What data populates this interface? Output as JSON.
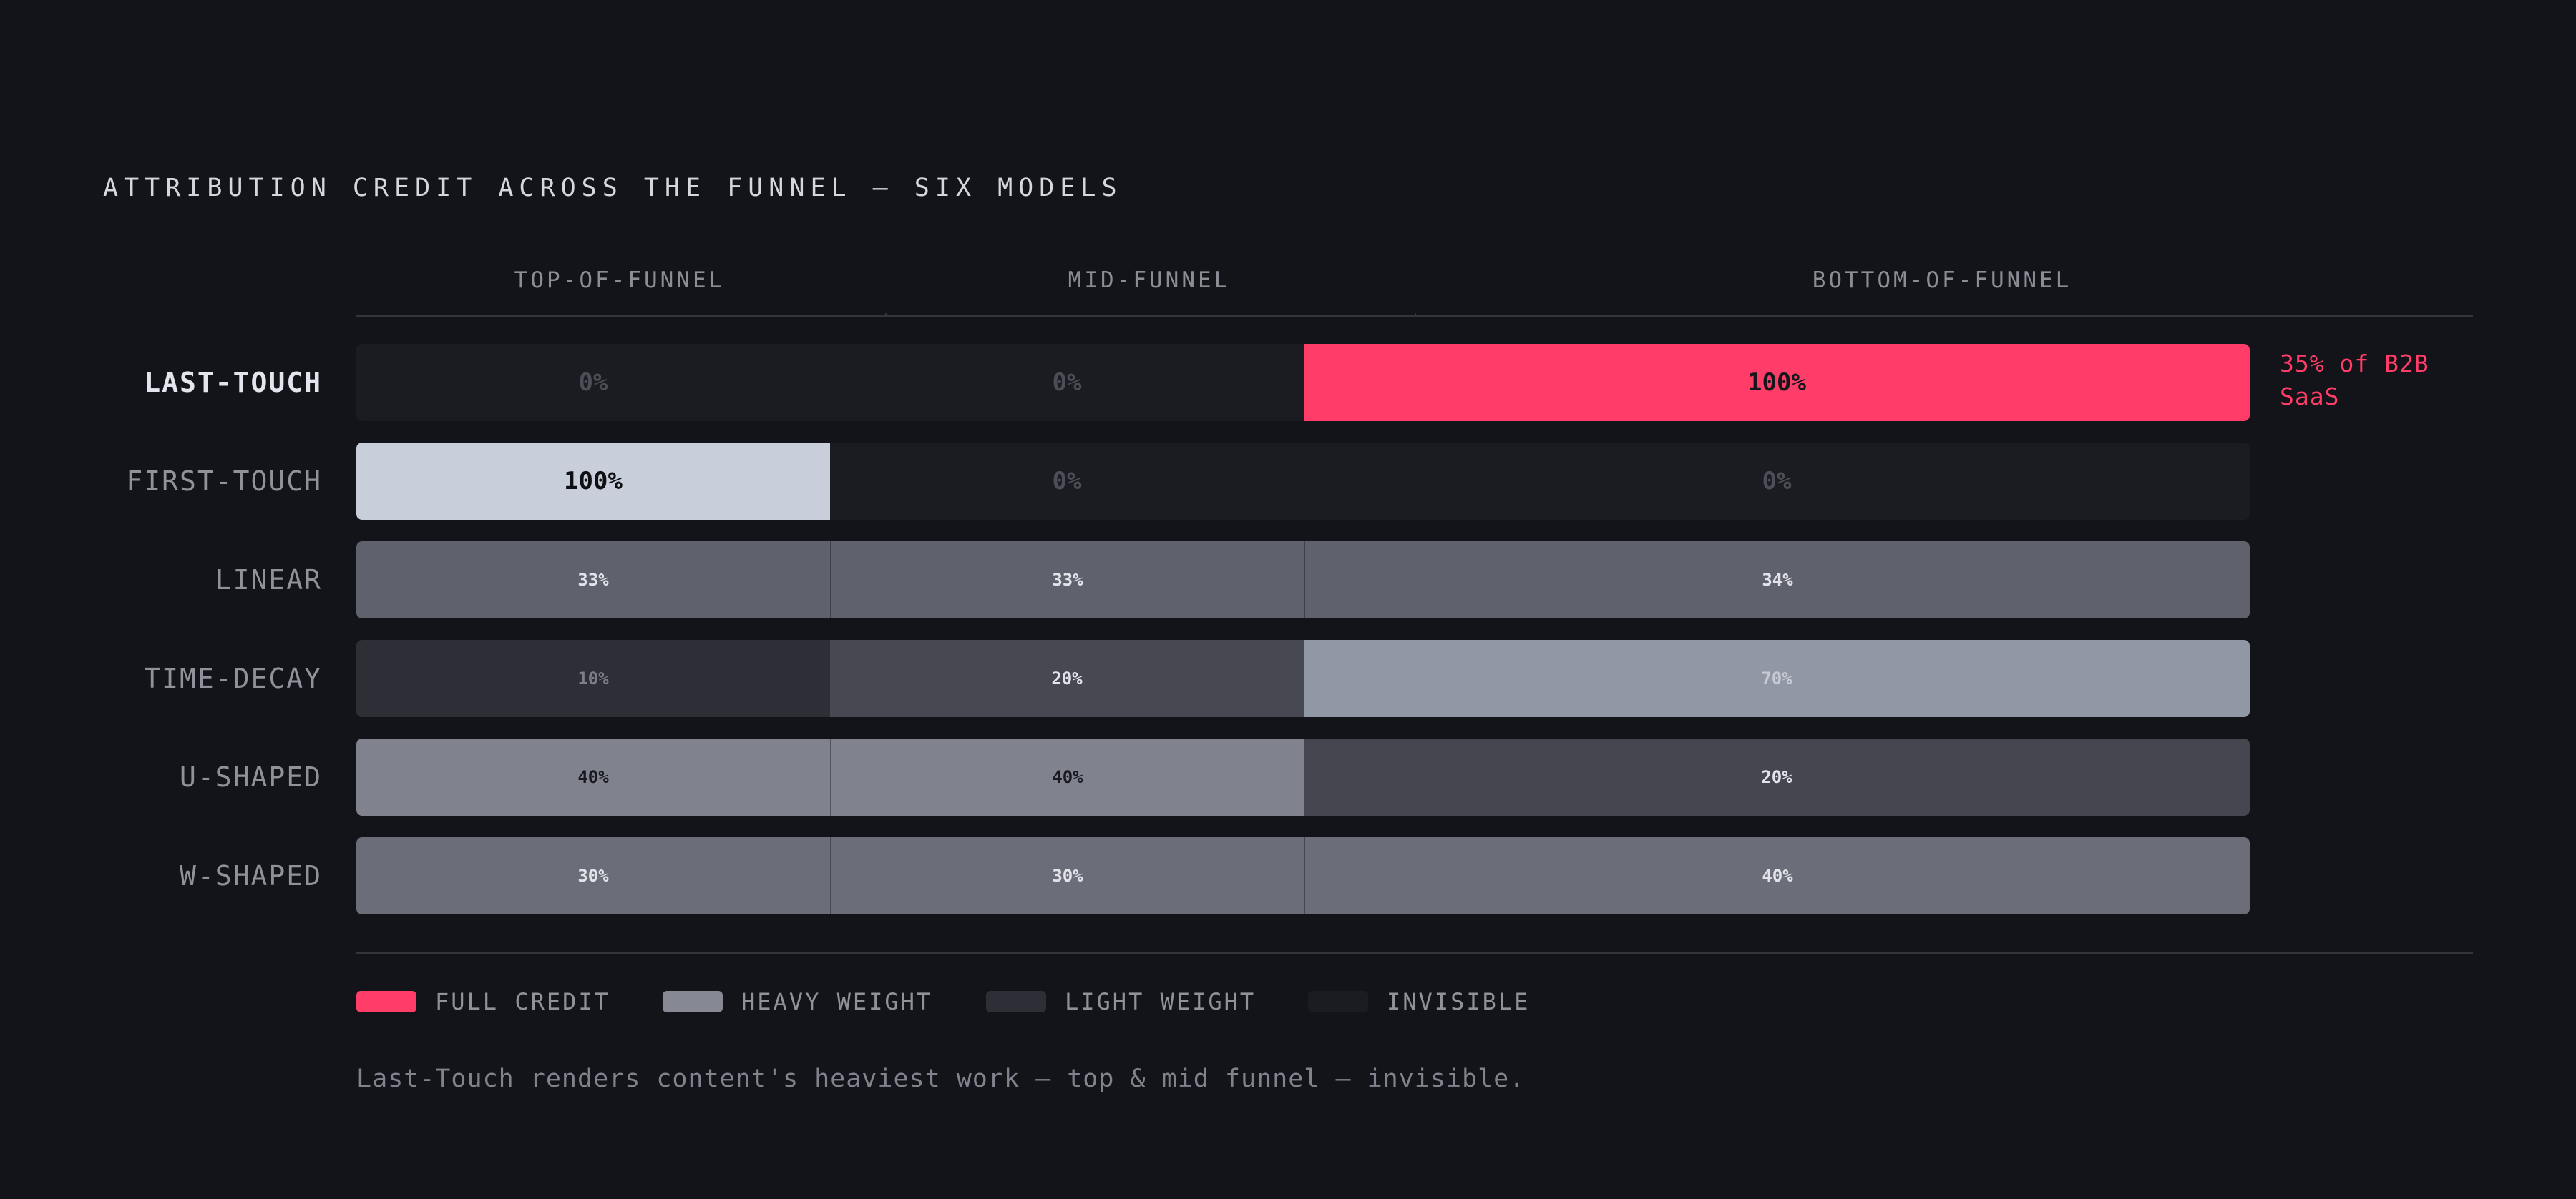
{
  "colors": {
    "background": "#131419",
    "full_credit": "#ff3d68",
    "heavy_weight": "#868894",
    "light_weight": "#2e2f36",
    "invisible": "#1b1c22"
  },
  "chart_data": {
    "type": "bar",
    "title": "ATTRIBUTION CREDIT ACROSS THE FUNNEL — SIX MODELS",
    "categories": [
      "TOP-OF-FUNNEL",
      "MID-FUNNEL",
      "BOTTOM-OF-FUNNEL"
    ],
    "unit": "%",
    "series": [
      {
        "name": "LAST-TOUCH",
        "values": [
          0,
          0,
          100
        ],
        "labels": [
          "0%",
          "0%",
          "100%"
        ],
        "fills": [
          "#1b1c22",
          "#1b1c22",
          "#ff3d68"
        ],
        "text_colors": [
          "#4c4e57",
          "#4c4e57",
          "#16171c"
        ],
        "emphasized": true
      },
      {
        "name": "FIRST-TOUCH",
        "values": [
          100,
          0,
          0
        ],
        "labels": [
          "100%",
          "0%",
          "0%"
        ],
        "fills": [
          "#c9cedb",
          "#1b1c22",
          "#1b1c22"
        ],
        "text_colors": [
          "#0f1014",
          "#4c4e57",
          "#4c4e57"
        ],
        "emphasized": false
      },
      {
        "name": "LINEAR",
        "values": [
          33,
          33,
          34
        ],
        "labels": [
          "33%",
          "33%",
          "34%"
        ],
        "fills": [
          "#5f616c",
          "#5f616c",
          "#5f616c"
        ],
        "text_colors": [
          "#e2e4ea",
          "#e2e4ea",
          "#e2e4ea"
        ],
        "emphasized": false
      },
      {
        "name": "TIME-DECAY",
        "values": [
          10,
          20,
          70
        ],
        "labels": [
          "10%",
          "20%",
          "70%"
        ],
        "fills": [
          "#2e2f36",
          "#474852",
          "#9097a5"
        ],
        "text_colors": [
          "#7c7e88",
          "#e2e4ea",
          "#c7cad3"
        ],
        "emphasized": false
      },
      {
        "name": "U-SHAPED",
        "values": [
          40,
          40,
          20
        ],
        "labels": [
          "40%",
          "40%",
          "20%"
        ],
        "fills": [
          "#80828d",
          "#80828d",
          "#454650"
        ],
        "text_colors": [
          "#18191e",
          "#18191e",
          "#e2e4ea"
        ],
        "emphasized": false
      },
      {
        "name": "W-SHAPED",
        "values": [
          30,
          30,
          40
        ],
        "labels": [
          "30%",
          "30%",
          "40%"
        ],
        "fills": [
          "#6b6d78",
          "#6b6d78",
          "#6b6d78"
        ],
        "text_colors": [
          "#e2e4ea",
          "#e2e4ea",
          "#e2e4ea"
        ],
        "emphasized": false
      }
    ],
    "annotation": "35% of B2B SaaS",
    "legend": [
      "FULL CREDIT",
      "HEAVY WEIGHT",
      "LIGHT WEIGHT",
      "INVISIBLE"
    ],
    "legend_placement": "bottom"
  },
  "caption": "Last-Touch renders content's heaviest work — top & mid funnel — invisible."
}
